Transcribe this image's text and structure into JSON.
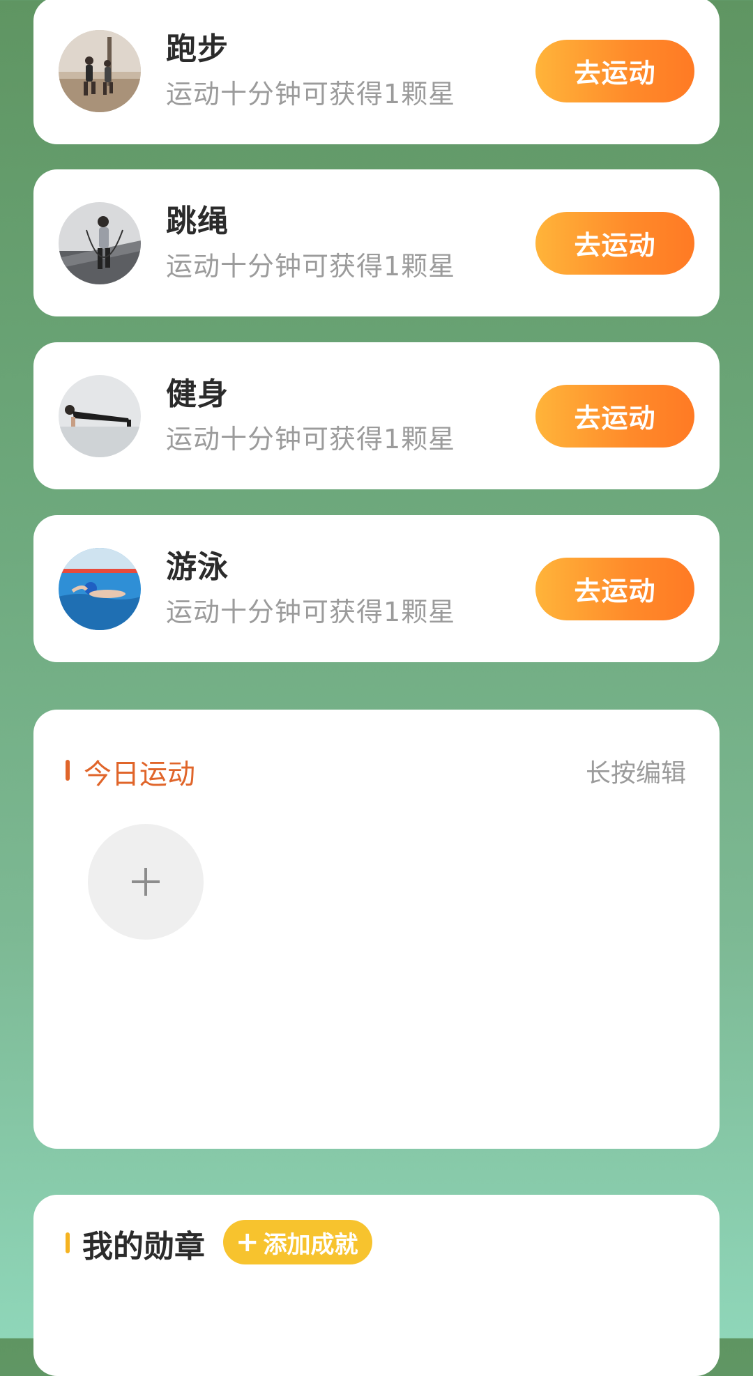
{
  "activities": [
    {
      "title": "跑步",
      "subtitle": "运动十分钟可获得1颗星",
      "button": "去运动",
      "avatar_icon": "running-photo-icon"
    },
    {
      "title": "跳绳",
      "subtitle": "运动十分钟可获得1颗星",
      "button": "去运动",
      "avatar_icon": "jump-rope-photo-icon"
    },
    {
      "title": "健身",
      "subtitle": "运动十分钟可获得1颗星",
      "button": "去运动",
      "avatar_icon": "fitness-photo-icon"
    },
    {
      "title": "游泳",
      "subtitle": "运动十分钟可获得1颗星",
      "button": "去运动",
      "avatar_icon": "swimming-photo-icon"
    }
  ],
  "today": {
    "title": "今日运动",
    "edit_hint": "长按编辑",
    "add_icon": "plus-icon"
  },
  "medals": {
    "title": "我的勋章",
    "add_label": "添加成就",
    "add_icon": "plus-icon"
  },
  "colors": {
    "background_top": "#5f9562",
    "background_bottom": "#8fd6b9",
    "button_gradient_start": "#ffb43a",
    "button_gradient_end": "#ff7a24",
    "today_accent": "#e0652a",
    "medal_accent": "#f5b321",
    "add_achievement_bg": "#f7c32e"
  }
}
